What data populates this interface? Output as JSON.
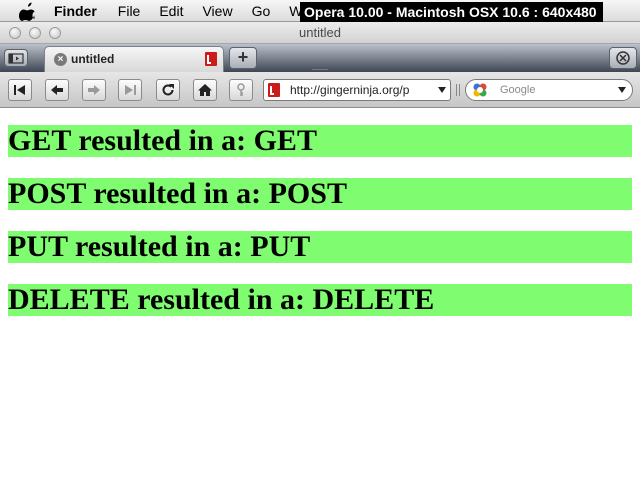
{
  "menubar": {
    "app_name": "Finder",
    "items": [
      "File",
      "Edit",
      "View",
      "Go",
      "W"
    ],
    "icons": [
      "apple-icon"
    ]
  },
  "overlay_caption": "Opera 10.00 - Macintosh OSX 10.6 : 640x480",
  "window": {
    "title": "untitled"
  },
  "tabbar": {
    "tabs": [
      {
        "label": "untitled",
        "active": true
      }
    ],
    "icons": [
      "panel-toggle-icon",
      "close-icon",
      "opera-icon",
      "plus-icon",
      "trash-icon"
    ]
  },
  "toolbar": {
    "icons": [
      "rewind-icon",
      "back-icon",
      "forward-icon",
      "fast-forward-icon",
      "reload-icon",
      "home-icon",
      "key-icon"
    ],
    "address": "http://gingerninja.org/p",
    "search_placeholder": "Google"
  },
  "content": {
    "background_color": "#7ffc70",
    "results": [
      "GET resulted in a: GET",
      "POST resulted in a: POST",
      "PUT resulted in a: PUT",
      "DELETE resulted in a: DELETE"
    ]
  }
}
